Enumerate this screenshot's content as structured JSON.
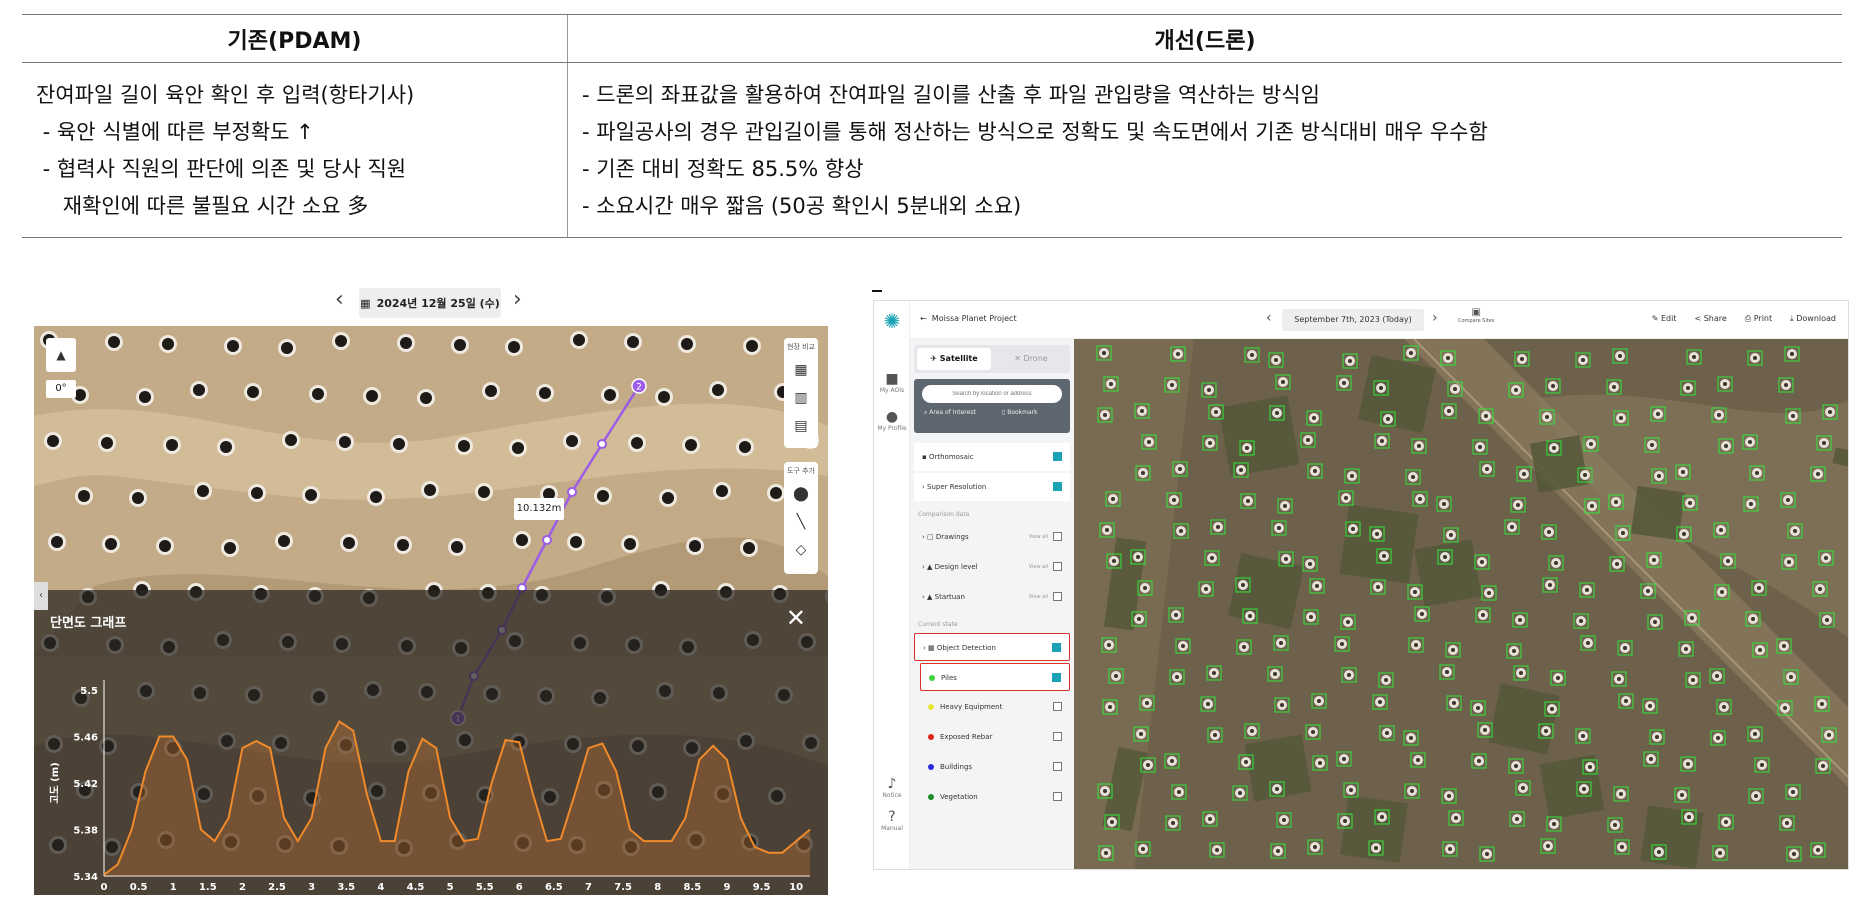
{
  "table": {
    "col1_header": "기존(PDAM)",
    "col2_header": "개선(드론)",
    "col1_lines": [
      "잔여파일 길이 육안 확인 후 입력(항타기사)",
      " - 육안 식별에 따른 부정확도 ↑",
      " - 협력사 직원의 판단에 의존 및 당사 직원",
      "    재확인에 따른 불필요 시간 소요 多"
    ],
    "col2_lines": [
      "- 드론의 좌표값을 활용하여 잔여파일 길이를 산출 후 파일 관입량을 역산하는 방식임",
      "- 파일공사의 경우 관입길이를 통해 정산하는 방식으로 정확도 및 속도면에서 기존 방식대비 매우 우수함",
      "- 기존 대비 정확도 85.5% 향상",
      "- 소요시간 매우 짧음 (50공 확인시 5분내외 소요)"
    ]
  },
  "left": {
    "date": "2024년 12월 25일 (수)",
    "prev_icon": "chevron-left-icon",
    "next_icon": "chevron-right-icon",
    "rotation": "0°",
    "tools_label": "현장 비교",
    "draw_label": "도구 추가",
    "distance": "10.132m",
    "point_a": "1",
    "point_b": "2",
    "graph_title": "단면도 그래프",
    "close": "✕"
  },
  "chart_data": {
    "type": "area",
    "title": "",
    "xlabel": "",
    "ylabel": "고도 (m)",
    "x_ticks": [
      "0",
      "0.5",
      "1",
      "1.5",
      "2",
      "2.5",
      "3",
      "3.5",
      "4",
      "4.5",
      "5",
      "5.5",
      "6",
      "6.5",
      "7",
      "7.5",
      "8",
      "8.5",
      "9",
      "9.5",
      "10"
    ],
    "y_ticks": [
      "5.5",
      "5.46",
      "5.42",
      "5.38",
      "5.34"
    ],
    "xlim": [
      0,
      10.2
    ],
    "ylim": [
      5.34,
      5.5
    ],
    "x": [
      0,
      0.2,
      0.4,
      0.6,
      0.8,
      1.0,
      1.2,
      1.4,
      1.6,
      1.8,
      2.0,
      2.2,
      2.4,
      2.6,
      2.8,
      3.0,
      3.2,
      3.4,
      3.6,
      3.8,
      4.0,
      4.2,
      4.4,
      4.6,
      4.8,
      5.0,
      5.2,
      5.4,
      5.6,
      5.8,
      6.0,
      6.2,
      6.4,
      6.6,
      6.8,
      7.0,
      7.2,
      7.4,
      7.6,
      7.8,
      8.0,
      8.2,
      8.4,
      8.6,
      8.8,
      9.0,
      9.2,
      9.4,
      9.6,
      9.8,
      10.0,
      10.2
    ],
    "y": [
      5.341,
      5.35,
      5.38,
      5.43,
      5.46,
      5.46,
      5.44,
      5.38,
      5.37,
      5.39,
      5.45,
      5.456,
      5.45,
      5.39,
      5.37,
      5.39,
      5.45,
      5.473,
      5.465,
      5.41,
      5.37,
      5.37,
      5.43,
      5.458,
      5.45,
      5.39,
      5.37,
      5.372,
      5.42,
      5.457,
      5.455,
      5.41,
      5.37,
      5.372,
      5.41,
      5.45,
      5.454,
      5.43,
      5.38,
      5.37,
      5.37,
      5.37,
      5.39,
      5.44,
      5.452,
      5.44,
      5.39,
      5.365,
      5.36,
      5.36,
      5.37,
      5.38
    ],
    "grid": false
  },
  "right": {
    "back": "←",
    "project": "Moissa Planet Project",
    "date": "September 7th, 2023 (Today)",
    "compare": "Compare Sites",
    "actions": [
      "Edit",
      "Share",
      "Print",
      "Download"
    ],
    "rail": [
      "My AOIs",
      "My Profile",
      "Notice",
      "Manual"
    ],
    "tabs": [
      "Satellite",
      "Drone"
    ],
    "search_placeholder": "Search by location or address",
    "search_buttons": [
      "Area of Interest",
      "Bookmark"
    ],
    "layers": [
      "Orthomosaic",
      "Super Resolution"
    ],
    "comparison_label": "Comparison data",
    "comparison": [
      "Drawings",
      "Design level",
      "Startuan"
    ],
    "view_all": "View all",
    "current_label": "Current state",
    "detection": "Object Detection",
    "classes": [
      {
        "name": "Piles",
        "color": "#3bd23b",
        "checked": true
      },
      {
        "name": "Heavy Equipment",
        "color": "#e8e83a",
        "checked": false
      },
      {
        "name": "Exposed Rebar",
        "color": "#e0241c",
        "checked": false
      },
      {
        "name": "Buildings",
        "color": "#2a2ae0",
        "checked": false
      },
      {
        "name": "Vegetation",
        "color": "#1a8a2a",
        "checked": false
      }
    ]
  }
}
